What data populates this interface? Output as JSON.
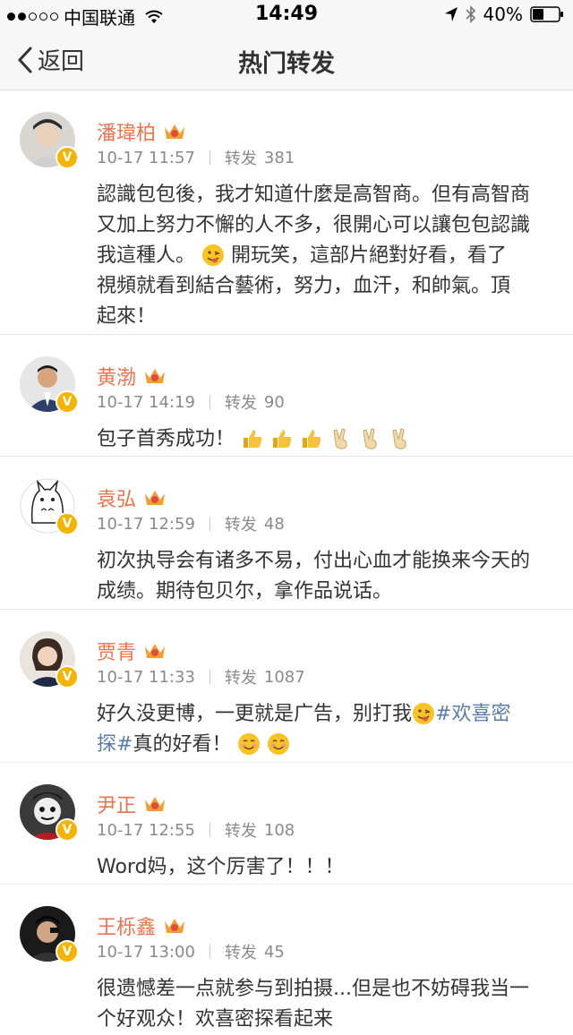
{
  "status_bar": {
    "carrier": "中国联通",
    "time": "14:49",
    "battery": "40%"
  },
  "nav": {
    "back_label": "返回",
    "title": "热门转发"
  },
  "labels": {
    "repost": "转发"
  },
  "posts": [
    {
      "name": "潘瑋柏",
      "time": "10-17 11:57",
      "reposts": "381",
      "lines": [
        "認識包包後，我才知道什麼是高智商。但有高智商",
        "又加上努力不懈的人不多，很開心可以讓包包認識",
        "我這種人。",
        "開玩笑，這部片絕對好看，看了",
        "視頻就看到結合藝術，努力，血汗，和帥氣。頂",
        "起來！"
      ]
    },
    {
      "name": "黄渤",
      "time": "10-17 14:19",
      "reposts": "90",
      "lines": [
        "包子首秀成功！"
      ]
    },
    {
      "name": "袁弘",
      "time": "10-17 12:59",
      "reposts": "48",
      "lines": [
        "初次执导会有诸多不易，付出心血才能换来今天的",
        "成绩。期待包贝尔，拿作品说话。"
      ]
    },
    {
      "name": "贾青",
      "time": "10-17 11:33",
      "reposts": "1087",
      "lines": [
        "好久没更博，一更就是广告，别打我",
        "#欢喜密",
        "探#",
        "真的好看！"
      ]
    },
    {
      "name": "尹正",
      "time": "10-17 12:55",
      "reposts": "108",
      "lines": [
        "Word妈，这个厉害了！！！"
      ]
    },
    {
      "name": "王栎鑫",
      "time": "10-17 13:00",
      "reposts": "45",
      "lines": [
        "很遗憾差一点就参与到拍摄...但是也不妨碍我当一",
        "个好观众！欢喜密探看起来"
      ]
    }
  ],
  "colors": {
    "name": "#eb7350",
    "meta": "#8a8a8a",
    "hashtag": "#5a7cab",
    "verified": "#f5b400"
  }
}
